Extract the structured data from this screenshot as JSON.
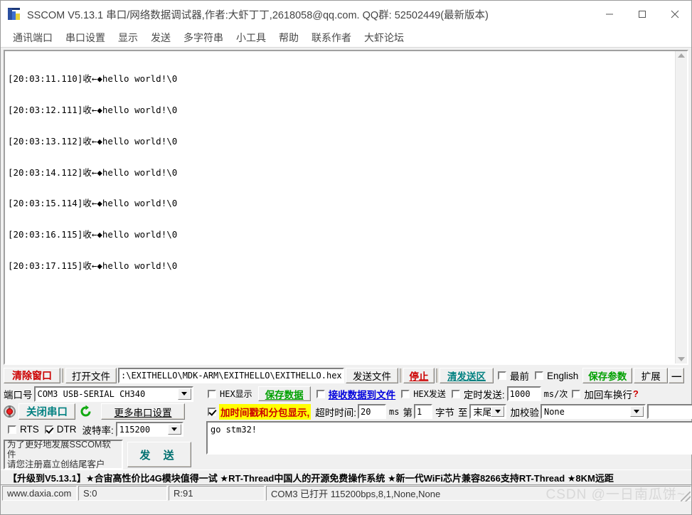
{
  "window": {
    "title": "SSCOM V5.13.1 串口/网络数据调试器,作者:大虾丁丁,2618058@qq.com. QQ群: 52502449(最新版本)",
    "minimize": "—",
    "maximize": "□",
    "close": "✕"
  },
  "menu": {
    "items": [
      {
        "label": "通讯端口"
      },
      {
        "label": "串口设置"
      },
      {
        "label": "显示"
      },
      {
        "label": "发送"
      },
      {
        "label": "多字符串"
      },
      {
        "label": "小工具"
      },
      {
        "label": "帮助"
      },
      {
        "label": "联系作者"
      },
      {
        "label": "大虾论坛"
      }
    ]
  },
  "receive": {
    "lines": [
      "[20:03:11.110]收←◆hello world!\\0",
      "[20:03:12.111]收←◆hello world!\\0",
      "[20:03:13.112]收←◆hello world!\\0",
      "[20:03:14.112]收←◆hello world!\\0",
      "[20:03:15.114]收←◆hello world!\\0",
      "[20:03:16.115]收←◆hello world!\\0",
      "[20:03:17.115]收←◆hello world!\\0"
    ]
  },
  "toolbar_row1": {
    "clear_window": "清除窗口",
    "open_file": "打开文件",
    "file_path": ":\\EXITHELLO\\MDK-ARM\\EXITHELLO\\EXITHELLO.hex",
    "send_file": "发送文件",
    "stop": "停止",
    "clear_send": "清发送区",
    "topmost": "最前",
    "topmost_checked": false,
    "english": "English",
    "english_checked": false,
    "save_params": "保存参数",
    "extend": "扩展",
    "collapse": "—"
  },
  "port_settings": {
    "port_label": "端口号",
    "port_value": "COM3 USB-SERIAL CH340",
    "close_port": "关闭串口",
    "more_settings": "更多串口设置",
    "rts_label": "RTS",
    "rts_checked": false,
    "dtr_label": "DTR",
    "dtr_checked": true,
    "baud_label": "波特率:",
    "baud_value": "115200",
    "register_text_line1": "为了更好地发展SSCOM软件",
    "register_text_line2": "请您注册嘉立创结尾客户",
    "send_button": "发 送"
  },
  "recv_options": {
    "hex_display": "HEX显示",
    "hex_display_checked": false,
    "save_data": "保存数据",
    "recv_to_file": "接收数据到文件",
    "recv_to_file_checked": false,
    "timestamp_label": "加时间戳和分包显示,",
    "timestamp_checked": true,
    "timeout_label": "超时时间:",
    "timeout_value": "20",
    "timeout_unit": "ms",
    "byte_prefix": "第",
    "byte_index": "1",
    "byte_label": "字节",
    "to_label": "至",
    "to_value": "末尾",
    "checksum_label": "加校验",
    "checksum_value": "None",
    "checksum_extra": ""
  },
  "send_options": {
    "hex_send": "HEX发送",
    "hex_send_checked": false,
    "timed_send": "定时发送:",
    "timed_send_checked": false,
    "interval_value": "1000",
    "interval_unit": "ms/次",
    "add_crlf": "加回车换行",
    "add_crlf_checked": false,
    "help_icon": "?"
  },
  "send_area": {
    "content": "go stm32!"
  },
  "ad": {
    "text": "【升级到V5.13.1】★合宙高性价比4G模块值得一试 ★RT-Thread中国人的开源免费操作系统 ★新一代WiFi芯片兼容8266支持RT-Thread ★8KM远距"
  },
  "status": {
    "site": "www.daxia.com",
    "sent": "S:0",
    "received": "R:91",
    "connection": "COM3 已打开  115200bps,8,1,None,None",
    "watermark": "CSDN @一日南瓜饼~"
  },
  "colors": {
    "red": "#cc0000",
    "green": "#00a000",
    "teal": "#008080",
    "blue": "#0000dd",
    "highlight": "#ffff00"
  }
}
